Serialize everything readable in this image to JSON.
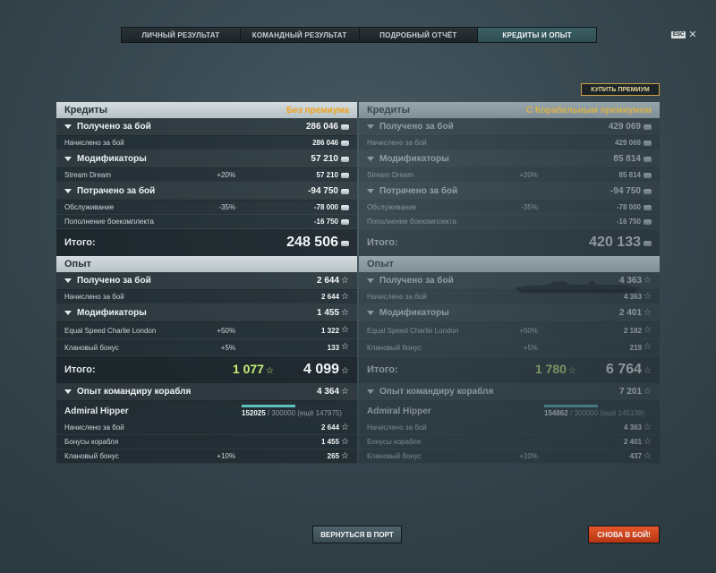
{
  "tabs": [
    {
      "label": "ЛИЧНЫЙ РЕЗУЛЬТАТ",
      "active": false
    },
    {
      "label": "КОМАНДНЫЙ РЕЗУЛЬТАТ",
      "active": false
    },
    {
      "label": "ПОДРОБНЫЙ ОТЧЁТ",
      "active": false
    },
    {
      "label": "КРЕДИТЫ И ОПЫТ",
      "active": true
    }
  ],
  "esc_label": "ESC",
  "buy_premium_label": "КУПИТЬ ПРЕМИУМ",
  "left": {
    "credits_title": "Кредиты",
    "credits_mode": "Без премиума",
    "earned_label": "Получено за бой",
    "earned_value": "286 046",
    "accrued_label": "Начислено за бой",
    "accrued_value": "286 046",
    "mods_label": "Модификаторы",
    "mods_value": "57 210",
    "mod1_label": "Stream Dream",
    "mod1_pct": "+20%",
    "mod1_value": "57 210",
    "spent_label": "Потрачено за бой",
    "spent_value": "-94 750",
    "service_label": "Обслуживание",
    "service_pct": "-35%",
    "service_value": "-78 000",
    "ammo_label": "Пополнение боекомплекта",
    "ammo_value": "-16 750",
    "total_label": "Итого:",
    "total_value": "248 506",
    "xp_title": "Опыт",
    "xp_earned_label": "Получено за бой",
    "xp_earned_value": "2 644",
    "xp_accrued_label": "Начислено за бой",
    "xp_accrued_value": "2 644",
    "xp_mods_label": "Модификаторы",
    "xp_mods_value": "1 455",
    "xp_mod1_label": "Equal Speed Charlie London",
    "xp_mod1_pct": "+50%",
    "xp_mod1_value": "1 322",
    "xp_clan_label": "Клановый бонус",
    "xp_clan_pct": "+5%",
    "xp_clan_value": "133",
    "xp_total_label": "Итого:",
    "xp_total_free": "1 077",
    "xp_total_value": "4 099",
    "cmdr_xp_label": "Опыт командиру корабля",
    "cmdr_xp_value": "4 364",
    "cmdr_name": "Admiral Hipper",
    "cmdr_progress_value": "152025",
    "cmdr_progress_rest": "/ 300000 (ещё 147975)",
    "cmdr_accrued_label": "Начислено за бой",
    "cmdr_accrued_value": "2 644",
    "cmdr_ship_bonus_label": "Бонусы корабля",
    "cmdr_ship_bonus_value": "1 455",
    "cmdr_clan_label": "Клановый бонус",
    "cmdr_clan_pct": "+10%",
    "cmdr_clan_value": "265"
  },
  "right": {
    "credits_title": "Кредиты",
    "credits_mode": "С Корабельным премиумом",
    "earned_label": "Получено за бой",
    "earned_value": "429 069",
    "accrued_label": "Начислено за бой",
    "accrued_value": "429 069",
    "mods_label": "Модификаторы",
    "mods_value": "85 814",
    "mod1_label": "Stream Dream",
    "mod1_pct": "+20%",
    "mod1_value": "85 814",
    "spent_label": "Потрачено за бой",
    "spent_value": "-94 750",
    "service_label": "Обслуживание",
    "service_pct": "-35%",
    "service_value": "-78 000",
    "ammo_label": "Пополнение боекомплекта",
    "ammo_value": "-16 750",
    "total_label": "Итого:",
    "total_value": "420 133",
    "xp_title": "Опыт",
    "xp_earned_label": "Получено за бой",
    "xp_earned_value": "4 363",
    "xp_accrued_label": "Начислено за бой",
    "xp_accrued_value": "4 363",
    "xp_mods_label": "Модификаторы",
    "xp_mods_value": "2 401",
    "xp_mod1_label": "Equal Speed Charlie London",
    "xp_mod1_pct": "+50%",
    "xp_mod1_value": "2 182",
    "xp_clan_label": "Клановый бонус",
    "xp_clan_pct": "+5%",
    "xp_clan_value": "219",
    "xp_total_label": "Итого:",
    "xp_total_free": "1 780",
    "xp_total_value": "6 764",
    "cmdr_xp_label": "Опыт командиру корабля",
    "cmdr_xp_value": "7 201",
    "cmdr_name": "Admiral Hipper",
    "cmdr_progress_value": "154862",
    "cmdr_progress_rest": "/ 300000 (ещё 145138)",
    "cmdr_accrued_label": "Начислено за бой",
    "cmdr_accrued_value": "4 363",
    "cmdr_ship_bonus_label": "Бонусы корабля",
    "cmdr_ship_bonus_value": "2 401",
    "cmdr_clan_label": "Клановый бонус",
    "cmdr_clan_pct": "+10%",
    "cmdr_clan_value": "437"
  },
  "back_to_port_label": "ВЕРНУТЬСЯ В ПОРТ",
  "battle_again_label": "СНОВА В БОЙ!",
  "colors": {
    "accent_teal": "#3a5f64",
    "premium_gold": "#f0a21c",
    "free_xp_green": "#c7f07a",
    "battle_button": "#d4481e"
  }
}
